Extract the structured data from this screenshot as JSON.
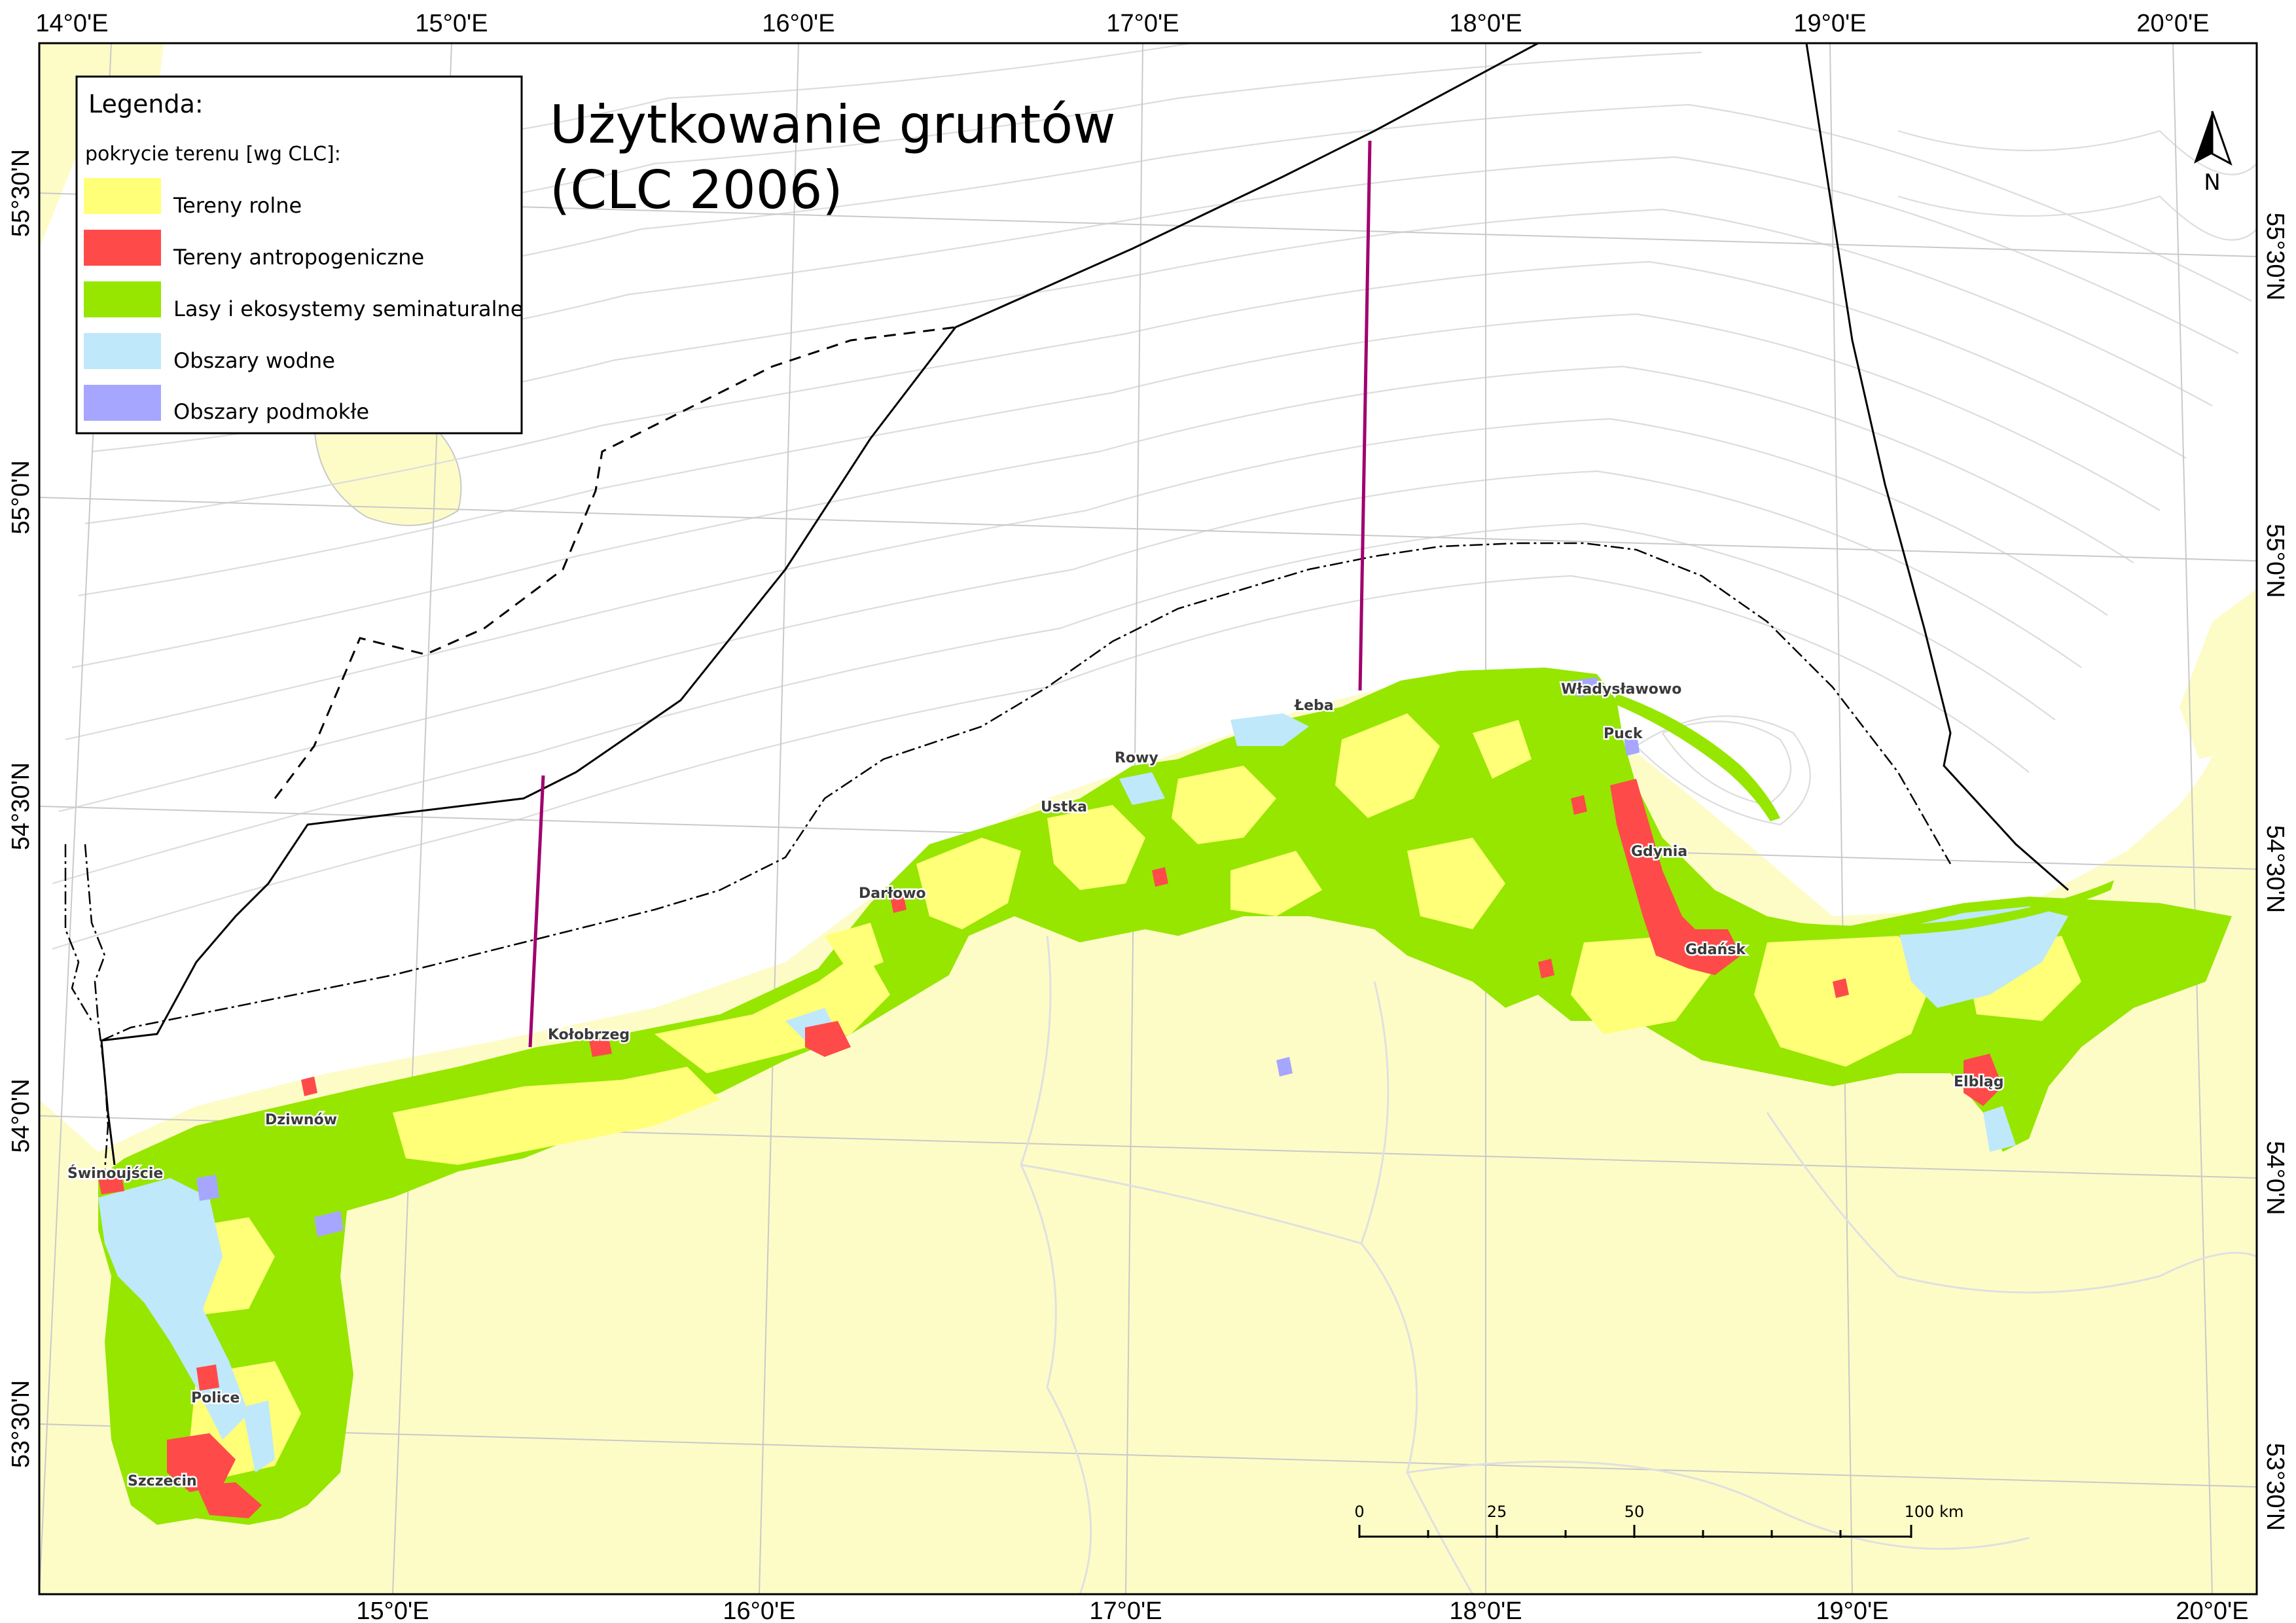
{
  "map": {
    "title_line1": "Użytkowanie gruntów",
    "title_line2": "(CLC 2006)",
    "legend": {
      "heading": "Legenda:",
      "subheading": "pokrycie terenu [wg CLC]:",
      "items": [
        {
          "label": "Tereny rolne",
          "color": "#ffff78"
        },
        {
          "label": "Tereny antropogeniczne",
          "color": "#ff4a4a"
        },
        {
          "label": "Lasy i ekosystemy seminaturalne",
          "color": "#96e600"
        },
        {
          "label": "Obszary wodne",
          "color": "#bfe8fa"
        },
        {
          "label": "Obszary podmokłe",
          "color": "#a6a6ff"
        }
      ]
    },
    "longitude_labels": [
      "14°0'E",
      "15°0'E",
      "16°0'E",
      "17°0'E",
      "18°0'E",
      "19°0'E",
      "20°0'E"
    ],
    "latitude_labels": [
      "55°30'N",
      "55°0'N",
      "54°30'N",
      "54°0'N",
      "53°30'N"
    ],
    "cities": [
      "Władysławowo",
      "Łeba",
      "Puck",
      "Rowy",
      "Ustka",
      "Gdynia",
      "Darłowo",
      "Gdańsk",
      "Kołobrzeg",
      "Elbląg",
      "Dziwnów",
      "Świnoujście",
      "Police",
      "Szczecin"
    ],
    "scale_bar": {
      "labels": [
        "0",
        "25",
        "50",
        "100 km"
      ]
    },
    "north_arrow": {
      "label": "N",
      "icon": "north-arrow-icon"
    },
    "colors": {
      "land_background": "#fdfcc7",
      "sea": "#ffffff",
      "agricultural": "#ffff78",
      "urban": "#ff4a4a",
      "forest": "#96e600",
      "water": "#bfe8fa",
      "wetland": "#a6a6ff",
      "boundary_purple": "#a0006e"
    }
  }
}
